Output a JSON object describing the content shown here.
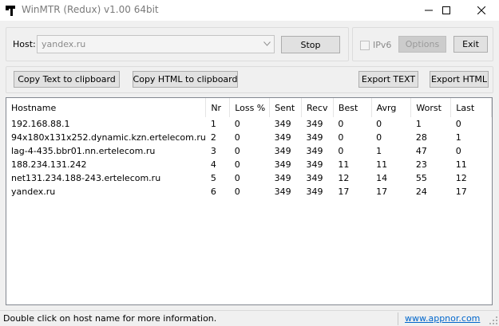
{
  "window": {
    "title": "WinMTR (Redux) v1.00 64bit",
    "icons": {
      "app": "hammer-icon",
      "minimize": "minimize-icon",
      "maximize": "maximize-icon",
      "close": "close-icon"
    }
  },
  "controls": {
    "host_label": "Host:",
    "host_value": "yandex.ru",
    "stop_label": "Stop",
    "ipv6_label": "IPv6",
    "options_label": "Options",
    "exit_label": "Exit"
  },
  "toolbar": {
    "copy_text_label": "Copy Text to clipboard",
    "copy_html_label": "Copy HTML to clipboard",
    "export_text_label": "Export TEXT",
    "export_html_label": "Export HTML"
  },
  "table": {
    "columns": [
      "Hostname",
      "Nr",
      "Loss %",
      "Sent",
      "Recv",
      "Best",
      "Avrg",
      "Worst",
      "Last"
    ],
    "rows": [
      [
        "192.168.88.1",
        "1",
        "0",
        "349",
        "349",
        "0",
        "0",
        "1",
        "0"
      ],
      [
        "94x180x131x252.dynamic.kzn.ertelecom.ru",
        "2",
        "0",
        "349",
        "349",
        "0",
        "0",
        "28",
        "1"
      ],
      [
        "lag-4-435.bbr01.nn.ertelecom.ru",
        "3",
        "0",
        "349",
        "349",
        "0",
        "1",
        "47",
        "0"
      ],
      [
        "188.234.131.242",
        "4",
        "0",
        "349",
        "349",
        "11",
        "11",
        "23",
        "11"
      ],
      [
        "net131.234.188-243.ertelecom.ru",
        "5",
        "0",
        "349",
        "349",
        "12",
        "14",
        "55",
        "12"
      ],
      [
        "yandex.ru",
        "6",
        "0",
        "349",
        "349",
        "17",
        "17",
        "24",
        "17"
      ]
    ]
  },
  "status": {
    "hint": "Double click on host name for more information.",
    "link": "www.appnor.com"
  }
}
